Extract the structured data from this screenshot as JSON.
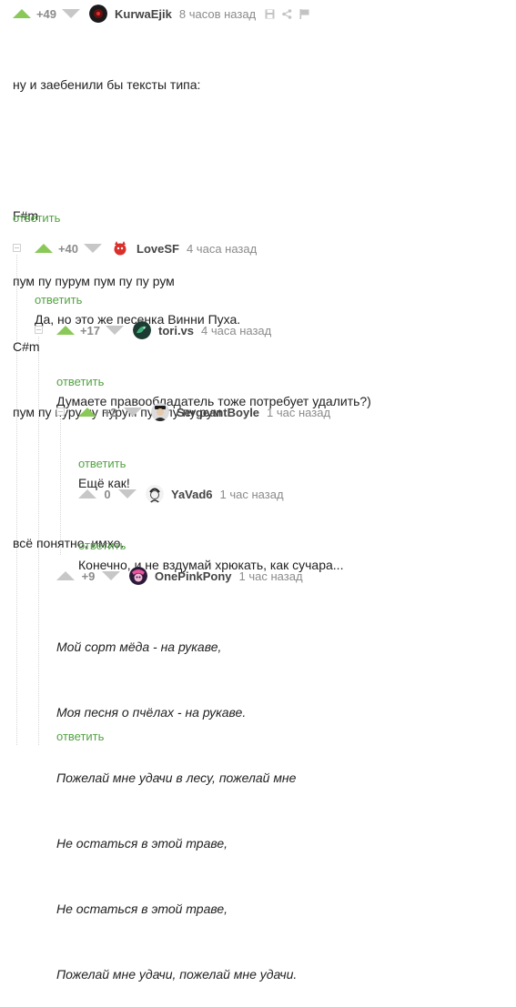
{
  "colors": {
    "accent_green": "#8ac858",
    "link_green": "#52a342",
    "grey_arrow": "#c7c7c7",
    "meta_grey": "#8b8b8b"
  },
  "comments": [
    {
      "rating": "+49",
      "nick": "KurwaEjik",
      "time": "8 часов назад",
      "avatar_icon": "dark-eye-avatar",
      "lines": [
        "ну и заебенили бы тексты типа:",
        "",
        "F#m",
        "пум пу пурум пум пу пу рум",
        "C#m",
        "пум пу пуру пу пурум пум пу пу рум",
        "",
        "всё понятно, имхо."
      ],
      "reply": "ответить"
    },
    {
      "rating": "+40",
      "nick": "LoveSF",
      "time": "4 часа назад",
      "avatar_icon": "red-cat-avatar",
      "lines": [
        "Да, но это же песенка Винни Пуха."
      ],
      "reply": "ответить"
    },
    {
      "rating": "+17",
      "nick": "tori.vs",
      "time": "4 часа назад",
      "avatar_icon": "green-bird-avatar",
      "lines": [
        "Думаете правообладатель тоже потребует удалить?)"
      ],
      "reply": "ответить"
    },
    {
      "rating": "+2",
      "nick": "SergeantBoyle",
      "time": "1 час назад",
      "avatar_icon": "officer-avatar",
      "lines": [
        "Ещё как!"
      ],
      "reply": "ответить"
    },
    {
      "rating": "0",
      "nick": "YaVad6",
      "time": "1 час назад",
      "avatar_icon": "sketch-face-avatar",
      "lines": [
        "Конечно, и не вздумай хрюкать, как сучара..."
      ],
      "reply": "ответить"
    },
    {
      "rating": "+9",
      "nick": "OnePinkPony",
      "time": "1 час назад",
      "avatar_icon": "pink-pony-avatar",
      "lines": [
        "Мой сорт мёда - на рукаве,",
        "Моя песня о пчёлах - на рукаве.",
        "Пожелай мне удачи в лесу, пожелай мне",
        "Не остаться в этой траве,",
        "Не остаться в этой траве,",
        "Пожелай мне удачи, пожелай мне удачи."
      ],
      "reply": "ответить"
    }
  ],
  "tool_icons": [
    "save-icon",
    "share-icon",
    "flag-icon"
  ]
}
